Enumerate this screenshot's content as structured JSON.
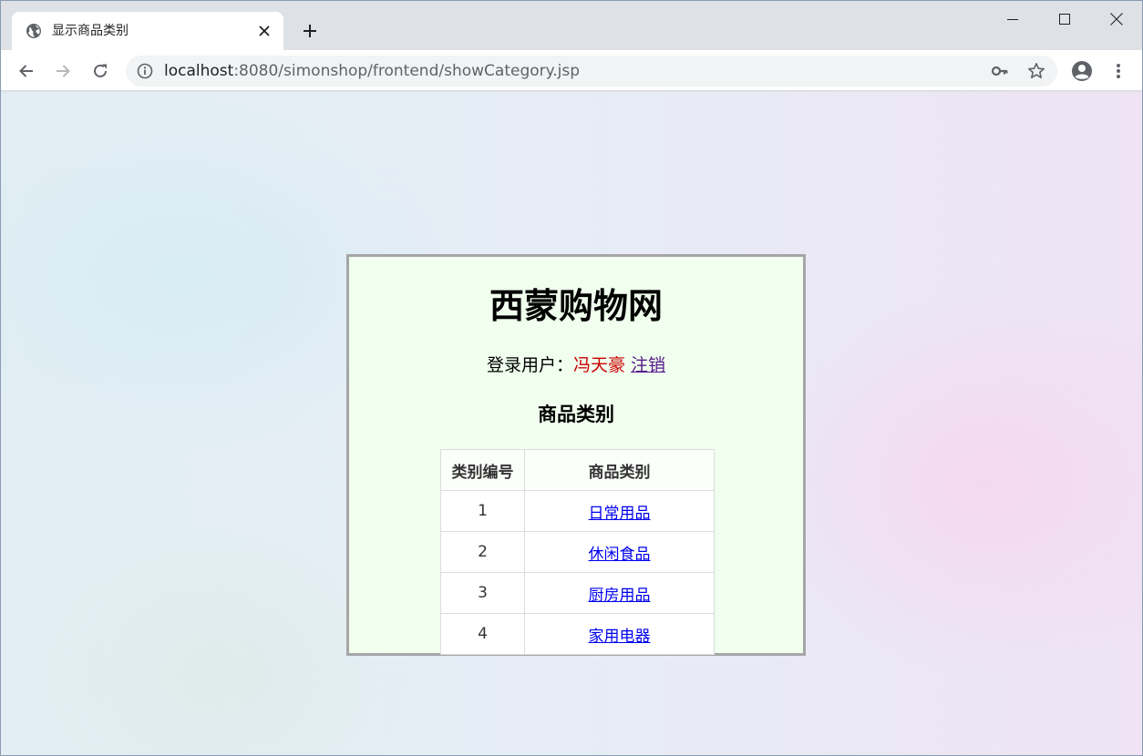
{
  "browser": {
    "tab_title": "显示商品类别",
    "url_host": "localhost",
    "url_rest": ":8080/simonshop/frontend/showCategory.jsp"
  },
  "page": {
    "site_title": "西蒙购物网",
    "login_label": "登录用户：",
    "username": "冯天豪",
    "logout_label": "注销",
    "section_title": "商品类别",
    "table": {
      "headers": [
        "类别编号",
        "商品类别"
      ],
      "rows": [
        {
          "id": "1",
          "name": "日常用品"
        },
        {
          "id": "2",
          "name": "休闲食品"
        },
        {
          "id": "3",
          "name": "厨房用品"
        },
        {
          "id": "4",
          "name": "家用电器"
        }
      ]
    }
  },
  "colors": {
    "panel_bg": "#f0ffee",
    "username": "#cc0000",
    "link": "#0000ee",
    "visited_link": "#551a8b"
  }
}
